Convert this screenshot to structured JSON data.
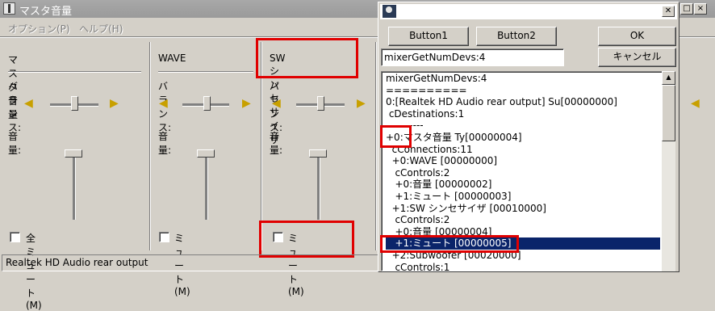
{
  "mixer": {
    "title": "マスタ音量",
    "menu": [
      "オプション(P)",
      "ヘルプ(H)"
    ],
    "channels": [
      {
        "name": "マスタ音量",
        "balance_label": "バランス:",
        "volume_label": "音量:",
        "mute_label": "全ミュート(M)",
        "muted": false
      },
      {
        "name": "WAVE",
        "balance_label": "バランス:",
        "volume_label": "音量:",
        "mute_label": "ミュート(M)",
        "muted": false
      },
      {
        "name": "SW シンセサイザ",
        "balance_label": "バランス:",
        "volume_label": "音量:",
        "mute_label": "ミュート(M)",
        "muted": false
      }
    ],
    "status": "Realtek HD Audio rear output"
  },
  "dialog": {
    "buttons": {
      "button1": "Button1",
      "button2": "Button2",
      "ok": "OK",
      "cancel": "キャンセル"
    },
    "input_value": "mixerGetNumDevs:4",
    "list_items": [
      "mixerGetNumDevs:4",
      "==========",
      "0:[Realtek HD Audio rear output] Su[00000000]",
      " cDestinations:1",
      "  ---------",
      "+0:マスタ音量 Ty[00000004]",
      "  cConnections:11",
      "  +0:WAVE [00000000]",
      "   cControls:2",
      "   +0:音量 [00000002]",
      "   +1:ミュート [00000003]",
      "  +1:SW シンセサイザ [00010000]",
      "   cControls:2",
      "   +0:音量 [00000004]",
      "   +1:ミュート [00000005]",
      "  +2:Subwoofer [00020000]",
      "   cControls:1"
    ],
    "selected_index": 14
  },
  "colors": {
    "highlight": "#e00000",
    "selection": "#0a246a"
  }
}
